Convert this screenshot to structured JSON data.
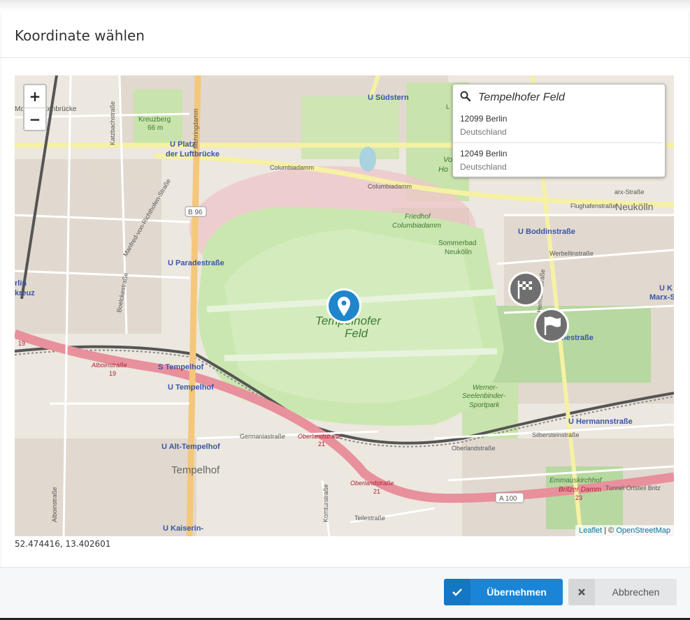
{
  "dialog": {
    "title": "Koordinate wählen"
  },
  "map": {
    "zoom_in_label": "+",
    "zoom_out_label": "−",
    "search": {
      "query": "Tempelhofer Feld",
      "results": [
        {
          "city": "12099 Berlin",
          "country": "Deutschland"
        },
        {
          "city": "12049 Berlin",
          "country": "Deutschland"
        }
      ]
    },
    "labels": {
      "tempelhofer_feld": "Tempelhofer",
      "feld": "Feld",
      "neukolln": "Neukölln",
      "tempelhof": "Tempelhof",
      "u_sudstern": "U Südstern",
      "u_platz": "U Platz",
      "der_luftbrucke": "der Luftbrücke",
      "u_paradestrasse": "U Paradestraße",
      "s_tempelhof": "S Tempelhof",
      "u_tempelhof": "U Tempelhof",
      "u_alt_tempelhof": "U Alt-Tempelhof",
      "u_kaiserin": "U Kaiserin-",
      "u_boddinstrasse": "U Boddinstraße",
      "u_hermannstrasse": "U Hermannstraße",
      "columbiadamm": "Columbiadamm",
      "columbiadamm2": "Columbiadamm",
      "friedhof": "Friedhof",
      "friedhof2": "Columbiadamm",
      "sommerbad": "Sommerbad",
      "sommerbad2": "Neukölln",
      "werner1": "Werner-",
      "werner2": "Seelenbinder-",
      "werner3": "Sportpark",
      "kreuzberg": "Kreuzberg",
      "kreuzberg_h": "66 m",
      "b96": "B 96",
      "a100": "A 100",
      "flughafenstrasse": "Flughafenstraße",
      "werbellinstrasse": "Werbellinstraße",
      "hermannstrasse": "Hermannstraße",
      "germaniastrasse": "Germaniastraße",
      "oberlandstrasse": "Oberlandstraße",
      "oberlandstrasse2": "Oberlandstraße",
      "oberlandstrasse3": "Oberlandstraße",
      "num21a": "21",
      "num21b": "21",
      "albstrasse": "Alboinstraße",
      "num19": "19",
      "num19b": "19",
      "silbersteinstrasse": "Silbersteinstraße",
      "emmaus": "Emmauskirchhof",
      "britzer": "Britzer Damm",
      "num23": "23",
      "tunnel": "Tunnel Ortsteil Britz",
      "komturstrasse": "Komturstraße",
      "teilestrasse": "Teilestraße",
      "albrechtstrasse": "Alboinstraße",
      "mehringdamm": "Mehringdamm",
      "katzbach": "Katzbachstraße",
      "manfred": "Manfred-von-Richthofen-Straße",
      "boelcke": "Boelckestraße",
      "monumenten": "Monumentenbrücke",
      "rlin": "rlin",
      "kreuz": "kreuz",
      "u_k": "U K",
      "marx": "Marx-S",
      "marx2": "arx-Straße",
      "ho": "Ho",
      "vo": "Vo",
      "nestrasse": "nestraße",
      "l_label": "L"
    },
    "attribution": {
      "leaflet": "Leaflet",
      "sep": " | © ",
      "osm": "OpenStreetMap"
    }
  },
  "coords_readout": "52.474416, 13.402601",
  "buttons": {
    "ok": "Übernehmen",
    "cancel": "Abbrechen"
  },
  "colors": {
    "primary": "#1a85d6",
    "marker": "#1f86cc",
    "park": "#c8e2a6"
  }
}
